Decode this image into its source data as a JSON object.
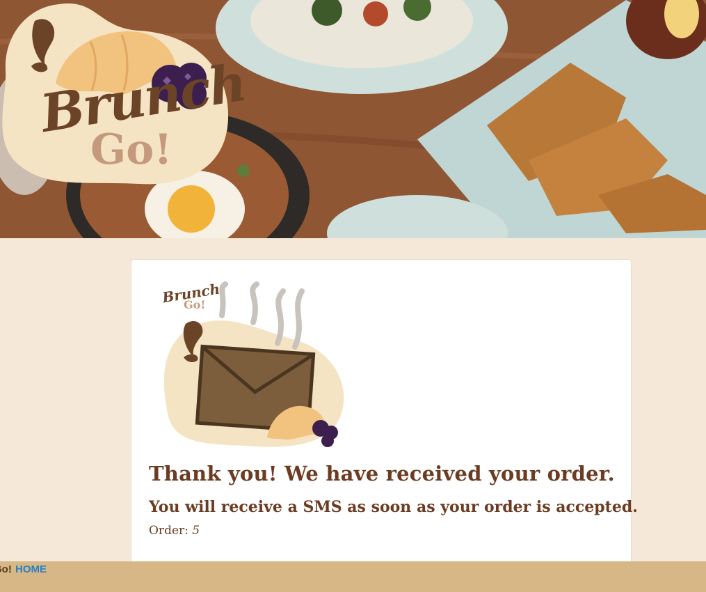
{
  "header": {
    "logo_line1": "Brunch",
    "logo_line2": "Go!",
    "hero_image": "brunch-table-photo"
  },
  "confirmation": {
    "illustration": "envelope-croissant-icon",
    "mini_logo_line1": "Brunch",
    "mini_logo_line2": "Go!",
    "title": "Thank you! We have received your order.",
    "subtitle": "You will receive a SMS as soon as your order is accepted.",
    "order_label": "Order:",
    "order_number": "5"
  },
  "footer": {
    "brand": "Go!",
    "home_link": "HOME"
  },
  "colors": {
    "page_background": "#f5e8d8",
    "brand_brown": "#6b3c22",
    "footer_background": "#d6b785",
    "link_blue": "#2f7fbf"
  }
}
